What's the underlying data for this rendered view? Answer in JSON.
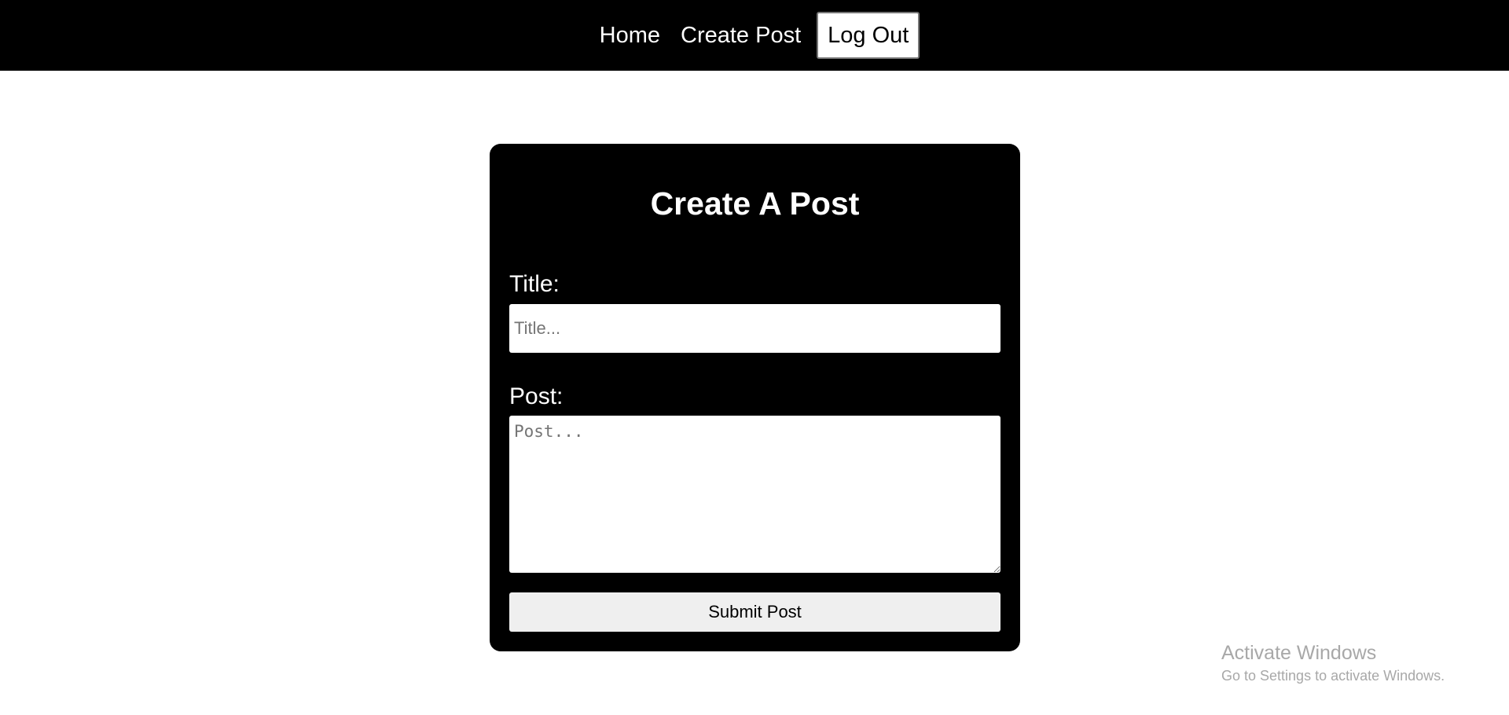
{
  "navbar": {
    "home_label": "Home",
    "create_post_label": "Create Post",
    "logout_label": "Log Out"
  },
  "form": {
    "heading": "Create A Post",
    "title_label": "Title:",
    "title_placeholder": "Title...",
    "title_value": "",
    "post_label": "Post:",
    "post_placeholder": "Post...",
    "post_value": "",
    "submit_label": "Submit Post"
  },
  "watermark": {
    "title": "Activate Windows",
    "subtitle": "Go to Settings to activate Windows."
  },
  "colors": {
    "navbar_bg": "#000000",
    "card_bg": "#000000",
    "page_bg": "#ffffff",
    "button_bg": "#efefef"
  }
}
